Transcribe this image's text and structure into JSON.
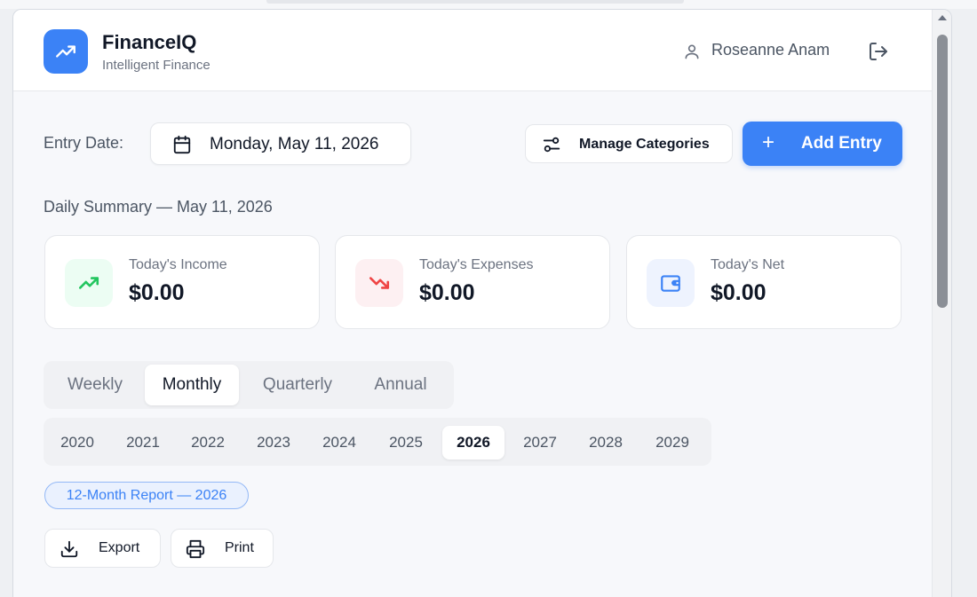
{
  "app": {
    "name": "FinanceIQ",
    "tagline": "Intelligent Finance",
    "user": "Roseanne Anam",
    "icons": {
      "logo": "trending-up-icon",
      "user": "user-icon",
      "logout": "logout-icon"
    }
  },
  "colors": {
    "accent": "#3b82f6",
    "income": "#22c55e",
    "expense": "#ef4444",
    "net": "#3b82f6"
  },
  "entry": {
    "label": "Entry Date:",
    "date": "Monday, May 11, 2026",
    "manage_label": "Manage Categories",
    "add_label": "Add Entry"
  },
  "summary": {
    "title": "Daily Summary — May 11, 2026",
    "cards": [
      {
        "label": "Today's Income",
        "value": "$0.00",
        "icon": "trending-up-icon"
      },
      {
        "label": "Today's Expenses",
        "value": "$0.00",
        "icon": "trending-down-icon"
      },
      {
        "label": "Today's Net",
        "value": "$0.00",
        "icon": "wallet-icon"
      }
    ]
  },
  "periods": {
    "tabs": [
      "Weekly",
      "Monthly",
      "Quarterly",
      "Annual"
    ],
    "selected": "Monthly"
  },
  "years": {
    "items": [
      "2020",
      "2021",
      "2022",
      "2023",
      "2024",
      "2025",
      "2026",
      "2027",
      "2028",
      "2029"
    ],
    "selected": "2026"
  },
  "report": {
    "badge": "12-Month Report — 2026",
    "export_label": "Export",
    "print_label": "Print"
  }
}
